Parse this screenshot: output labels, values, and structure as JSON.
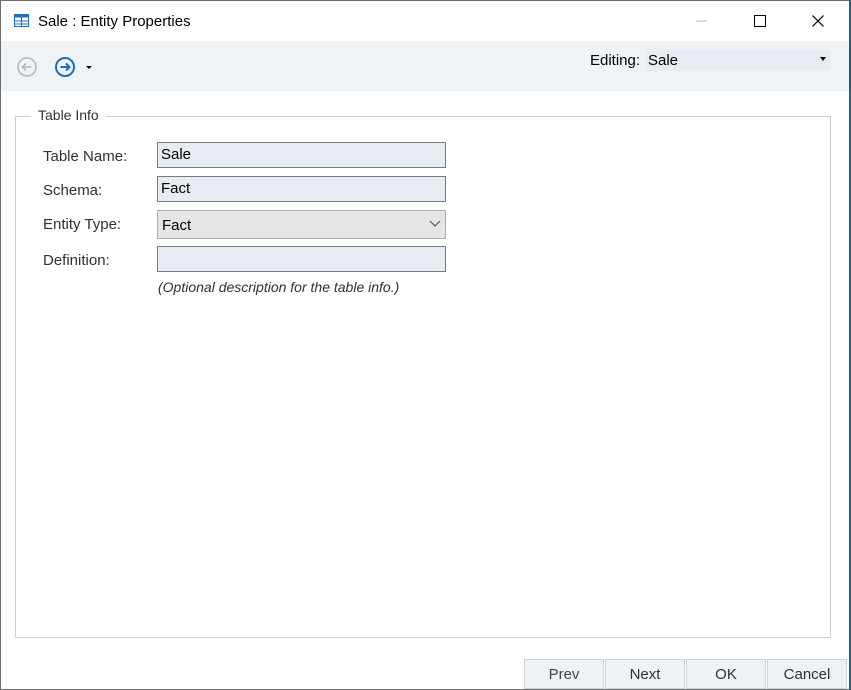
{
  "window": {
    "title": "Sale : Entity Properties",
    "icon": "table-icon"
  },
  "toolbar": {
    "back_icon": "arrow-left-circle-icon",
    "forward_icon": "arrow-right-circle-icon",
    "dropdown_icon": "caret-down-icon",
    "editing_label": "Editing:",
    "editing_value": "Sale"
  },
  "table_info": {
    "group_title": "Table Info",
    "table_name_label": "Table Name:",
    "table_name_value": "Sale",
    "schema_label": "Schema:",
    "schema_value": "Fact",
    "entity_type_label": "Entity Type:",
    "entity_type_value": "Fact",
    "definition_label": "Definition:",
    "definition_value": "",
    "definition_hint": "(Optional description for the table info.)"
  },
  "footer": {
    "prev_label": "Prev",
    "next_label": "Next",
    "ok_label": "OK",
    "cancel_label": "Cancel"
  },
  "colors": {
    "field_background": "#e6ecf1",
    "toolbar_background": "#f0f3f6",
    "accent": "#1e6fc0"
  }
}
